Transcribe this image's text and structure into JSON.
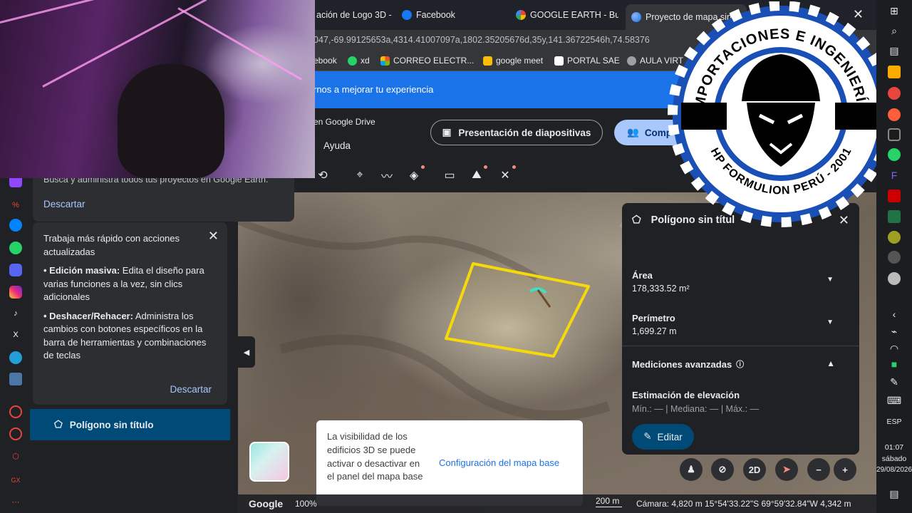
{
  "browser": {
    "tabs": [
      {
        "label": "ación de Logo 3D -",
        "icon": "tab-icon"
      },
      {
        "label": "Facebook",
        "icon": "facebook-icon"
      },
      {
        "label": "GOOGLE EARTH - Busc",
        "icon": "google-icon"
      },
      {
        "label": "Proyecto de mapa sin tí",
        "icon": "earth-icon"
      }
    ],
    "url": "047,-69.99125653a,4314.41007097a,1802.35205676d,35y,141.36722546h,74.58376",
    "bookmarks": [
      {
        "label": "ebook",
        "color": "#1877f2"
      },
      {
        "label": "xd",
        "color": "#25d366"
      },
      {
        "label": "CORREO ELECTR...",
        "color": "#f25022"
      },
      {
        "label": "google meet",
        "color": "#fbbc04"
      },
      {
        "label": "PORTAL SAE",
        "color": "#ffffff"
      },
      {
        "label": "AULA VIRT",
        "color": "#9aa0a6"
      }
    ]
  },
  "infobar": {
    "text": "rnos a mejorar tu experiencia"
  },
  "appbar": {
    "drive_text": "en Google Drive",
    "help": "Ayuda",
    "slideshow_label": "Presentación de diapositivas",
    "share_label": "Comp"
  },
  "left_panel": {
    "card1_faint": "Busca y administra todos tus proyectos en Google Earth.",
    "card1_dismiss": "Descartar",
    "card2_title": "Trabaja más rápido con acciones actualizadas",
    "bullet1_bold": "• Edición masiva:",
    "bullet1_text": " Edita el diseño para varias funciones a la vez, sin clics adicionales",
    "bullet2_bold": "• Deshacer/Rehacer:",
    "bullet2_text": " Administra los cambios con botones específicos en la barra de herramientas y combinaciones de teclas",
    "card2_dismiss": "Descartar",
    "polygon_item": "Polígono sin título"
  },
  "map": {
    "toast_text": "La visibilidad de los edificios 3D se puede activar o desactivar en el panel del mapa base",
    "toast_link": "Configuración del mapa base",
    "google_label": "Google",
    "zoom_pct": "100%",
    "scale": "200 m",
    "camera": "Cámara: 4,820 m     15°54'33.22\"S 69°59'32.84\"W   4,342 m",
    "polygon_color": "#f5d90a"
  },
  "right_panel": {
    "title": "Polígono sin títul",
    "area_label": "Área",
    "area_value": "178,333.52 m²",
    "perimeter_label": "Perímetro",
    "perimeter_value": "1,699.27 m",
    "advanced_label": "Mediciones avanzadas",
    "elevation_label": "Estimación de elevación",
    "elevation_values": "Mín.: — | Mediana: — | Máx.: —",
    "edit_label": "Editar"
  },
  "map_controls": {
    "view_2d": "2D"
  },
  "logo": {
    "top_text": "IMPORTACIONES E INGENIERÍA",
    "bottom_text": "HP FORMULION PERÚ - 2001",
    "primary_color": "#1a4fb5"
  },
  "taskbar": {
    "lang": "ESP",
    "time": "01:07",
    "day": "sábado",
    "date": "29/08/2026"
  }
}
